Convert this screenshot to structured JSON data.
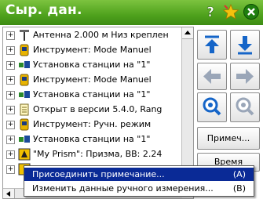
{
  "app": {
    "title": "Сыр. дан."
  },
  "titlebar": {
    "icons": [
      "help-icon",
      "star-icon",
      "close-icon"
    ],
    "help_glyph": "?",
    "close_glyph": "✕"
  },
  "tree": {
    "rows": [
      {
        "icon": "antenna-icon",
        "text": "Антенна 2.000 м Низ креплен"
      },
      {
        "icon": "instrument-icon",
        "text": "Инструмент: Mode Manuel"
      },
      {
        "icon": "station-setup-icon",
        "text": "Установка станции на \"1\""
      },
      {
        "icon": "instrument-icon",
        "text": "Инструмент: Mode Manuel"
      },
      {
        "icon": "station-setup-icon",
        "text": "Установка станции на \"1\""
      },
      {
        "icon": "document-icon",
        "text": "Открыт в версии 5.4.0, Rang"
      },
      {
        "icon": "instrument-icon",
        "text": "Инструмент: Ручн. режим"
      },
      {
        "icon": "station-setup-icon",
        "text": "Установка станции на \"1\""
      },
      {
        "icon": "prism-icon",
        "text": "\"My Prism\": Призма, BB: 2.24"
      }
    ],
    "expander_glyph": "+"
  },
  "side_buttons": {
    "note_label": "Примеч...",
    "time_label": "Время"
  },
  "menu": {
    "items": [
      {
        "label": "Присоединить примечание...",
        "key": "(A)",
        "selected": true
      },
      {
        "label": "Изменить данные ручного измерения...",
        "key": "(B)",
        "selected": false
      }
    ]
  },
  "colors": {
    "title_green": "#4fa21d",
    "accent_blue": "#1565c8",
    "selection": "#0a2a96"
  }
}
